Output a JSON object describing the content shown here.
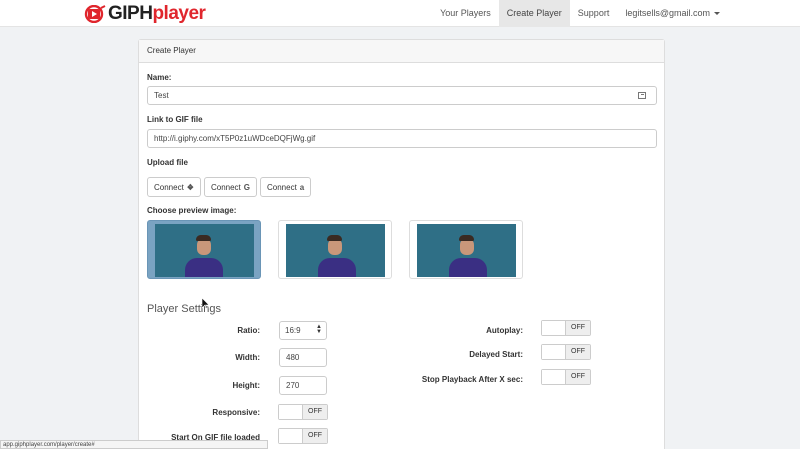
{
  "brand": {
    "part1": "GIPH",
    "part2": "player"
  },
  "nav": {
    "items": [
      "Your Players",
      "Create Player",
      "Support"
    ],
    "user": "legitsells@gmail.com"
  },
  "panel": {
    "title": "Create Player"
  },
  "form": {
    "name_label": "Name:",
    "name_value": "Test",
    "gif_label": "Link to GIF file",
    "gif_value": "http://i.giphy.com/xT5P0z1uWDceDQFjWg.gif",
    "upload_label": "Upload file",
    "connect_buttons": [
      {
        "label": "Connect",
        "icon": "dropbox-icon",
        "glyph": "❖"
      },
      {
        "label": "Connect",
        "icon": "google-icon",
        "glyph": "G"
      },
      {
        "label": "Connect",
        "icon": "amazon-icon",
        "glyph": "a"
      }
    ],
    "preview_label": "Choose preview image:",
    "previews_selected_index": 0
  },
  "settings": {
    "title": "Player Settings",
    "ratio_label": "Ratio:",
    "ratio_value": "16:9",
    "width_label": "Width:",
    "width_value": "480",
    "height_label": "Height:",
    "height_value": "270",
    "responsive_label": "Responsive:",
    "responsive_state": "OFF",
    "start_on_load_label": "Start On GIF file loaded",
    "start_on_load_state": "OFF",
    "autoplay_label": "Autoplay:",
    "autoplay_state": "OFF",
    "delayed_start_label": "Delayed Start:",
    "delayed_start_state": "OFF",
    "stop_playback_label": "Stop Playback After X sec:",
    "stop_playback_state": "OFF"
  },
  "status_url": "app.giphplayer.com/player/create#",
  "colors": {
    "brand_red": "#e0262d",
    "selected_preview": "#7aa3c2",
    "gif_bg": "#2f6f86",
    "jacket": "#3a2f83"
  }
}
